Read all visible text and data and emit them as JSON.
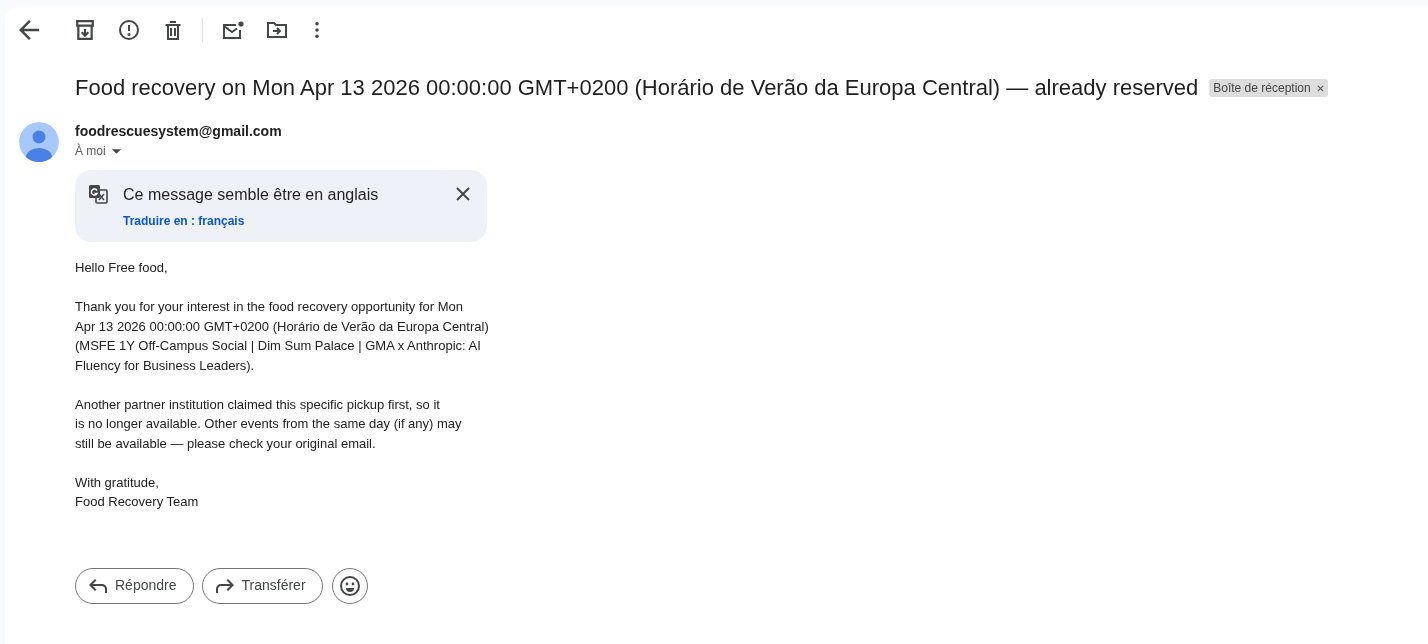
{
  "subject": "Food recovery on Mon Apr 13 2026 00:00:00 GMT+0200 (Horário de Verão da Europa Central) — already reserved",
  "labels": [
    {
      "text": "Boîte de réception"
    }
  ],
  "sender": {
    "email": "foodrescuesystem@gmail.com",
    "recipients": "À moi"
  },
  "translation_banner": {
    "message": "Ce message semble être en anglais",
    "link": "Traduire en : français"
  },
  "body": {
    "paragraphs": [
      {
        "lines": [
          "Hello Free food,"
        ]
      },
      {
        "lines": [
          "Thank you for your interest in the food recovery opportunity for Mon",
          "Apr 13 2026 00:00:00 GMT+0200 (Horário de Verão da Europa Central)",
          "(MSFE 1Y Off-Campus Social | Dim Sum Palace | GMA x Anthropic: AI",
          "Fluency for Business Leaders)."
        ]
      },
      {
        "lines": [
          "Another partner institution claimed this specific pickup first, so it",
          "is no longer available. Other events from the same day (if any) may",
          "still be available — please check your original email."
        ]
      },
      {
        "lines": [
          "With gratitude,",
          "Food Recovery Team"
        ]
      }
    ]
  },
  "actions": [
    {
      "kind": "reply",
      "label": "Répondre"
    },
    {
      "kind": "forward",
      "label": "Transférer"
    },
    {
      "kind": "emoji"
    }
  ]
}
